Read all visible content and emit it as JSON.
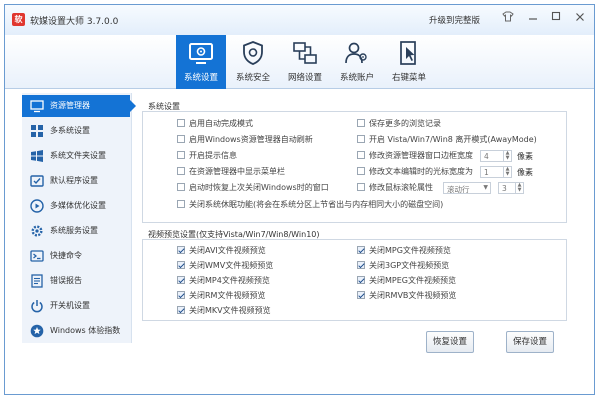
{
  "app": {
    "title": "软媒设置大师 3.7.0.0",
    "upgrade_label": "升级到完整版",
    "icon_letter": "软"
  },
  "titlebar_icons": {
    "skin": "shirt-icon",
    "minimize": "minimize-icon",
    "maximize": "maximize-icon",
    "close": "close-icon"
  },
  "toolbar": {
    "items": [
      {
        "label": "系统设置",
        "icon": "system-settings-icon",
        "active": true
      },
      {
        "label": "系统安全",
        "icon": "shield-gear-icon",
        "active": false
      },
      {
        "label": "网络设置",
        "icon": "network-icon",
        "active": false
      },
      {
        "label": "系统账户",
        "icon": "user-accounts-icon",
        "active": false
      },
      {
        "label": "右键菜单",
        "icon": "cursor-menu-icon",
        "active": false
      }
    ]
  },
  "sidebar": {
    "items": [
      {
        "label": "资源管理器",
        "icon": "monitor-icon",
        "active": true
      },
      {
        "label": "多系统设置",
        "icon": "grid-icon",
        "active": false
      },
      {
        "label": "系统文件夹设置",
        "icon": "windows-folder-icon",
        "active": false
      },
      {
        "label": "默认程序设置",
        "icon": "default-program-icon",
        "active": false
      },
      {
        "label": "多媒体优化设置",
        "icon": "media-icon",
        "active": false
      },
      {
        "label": "系统服务设置",
        "icon": "services-gear-icon",
        "active": false
      },
      {
        "label": "快捷命令",
        "icon": "command-icon",
        "active": false
      },
      {
        "label": "错误报告",
        "icon": "error-report-icon",
        "active": false
      },
      {
        "label": "开关机设置",
        "icon": "power-icon",
        "active": false
      },
      {
        "label": "Windows 体验指数",
        "icon": "star-icon",
        "active": false
      }
    ]
  },
  "system_settings": {
    "title": "系统设置",
    "left_options": [
      {
        "label": "启用自动完成模式",
        "checked": false
      },
      {
        "label": "启用Windows资源管理器自动刷新",
        "checked": false
      },
      {
        "label": "开启提示信息",
        "checked": false
      },
      {
        "label": "在资源管理器中显示菜单栏",
        "checked": false
      },
      {
        "label": "启动时恢复上次关闭Windows时的窗口",
        "checked": false
      }
    ],
    "right_options": [
      {
        "label": "保存更多的浏览记录",
        "checked": false
      },
      {
        "label": "开启 Vista/Win7/Win8 离开模式(AwayMode)",
        "checked": false
      },
      {
        "label": "修改资源管理器窗口边框宽度",
        "checked": false
      },
      {
        "label": "修改文本编辑时的光标宽度为",
        "checked": false
      },
      {
        "label": "修改鼠标滚轮属性",
        "checked": false
      }
    ],
    "border_width_value": "4",
    "cursor_width_value": "1",
    "pixel_unit": "像素",
    "wheel_mode_value": "滚动行",
    "wheel_lines_value": "3",
    "full_option": {
      "label": "关闭系统休眠功能(将会在系统分区上节省出与内存相同大小的磁盘空间)",
      "checked": false
    }
  },
  "video_preview": {
    "title": "视频预览设置(仅支持Vista/Win7/Win8/Win10)",
    "left_options": [
      {
        "label": "关闭AVI文件视频预览",
        "checked": true
      },
      {
        "label": "关闭WMV文件视频预览",
        "checked": true
      },
      {
        "label": "关闭MP4文件视频预览",
        "checked": true
      },
      {
        "label": "关闭RM文件视频预览",
        "checked": true
      },
      {
        "label": "关闭MKV文件视频预览",
        "checked": true
      }
    ],
    "right_options": [
      {
        "label": "关闭MPG文件视频预览",
        "checked": true
      },
      {
        "label": "关闭3GP文件视频预览",
        "checked": true
      },
      {
        "label": "关闭MPEG文件视频预览",
        "checked": true
      },
      {
        "label": "关闭RMVB文件视频预览",
        "checked": true
      }
    ]
  },
  "footer": {
    "restore_label": "恢复设置",
    "save_label": "保存设置"
  },
  "colors": {
    "accent": "#1473d5",
    "sidebar_bg": "#eef3fa"
  }
}
